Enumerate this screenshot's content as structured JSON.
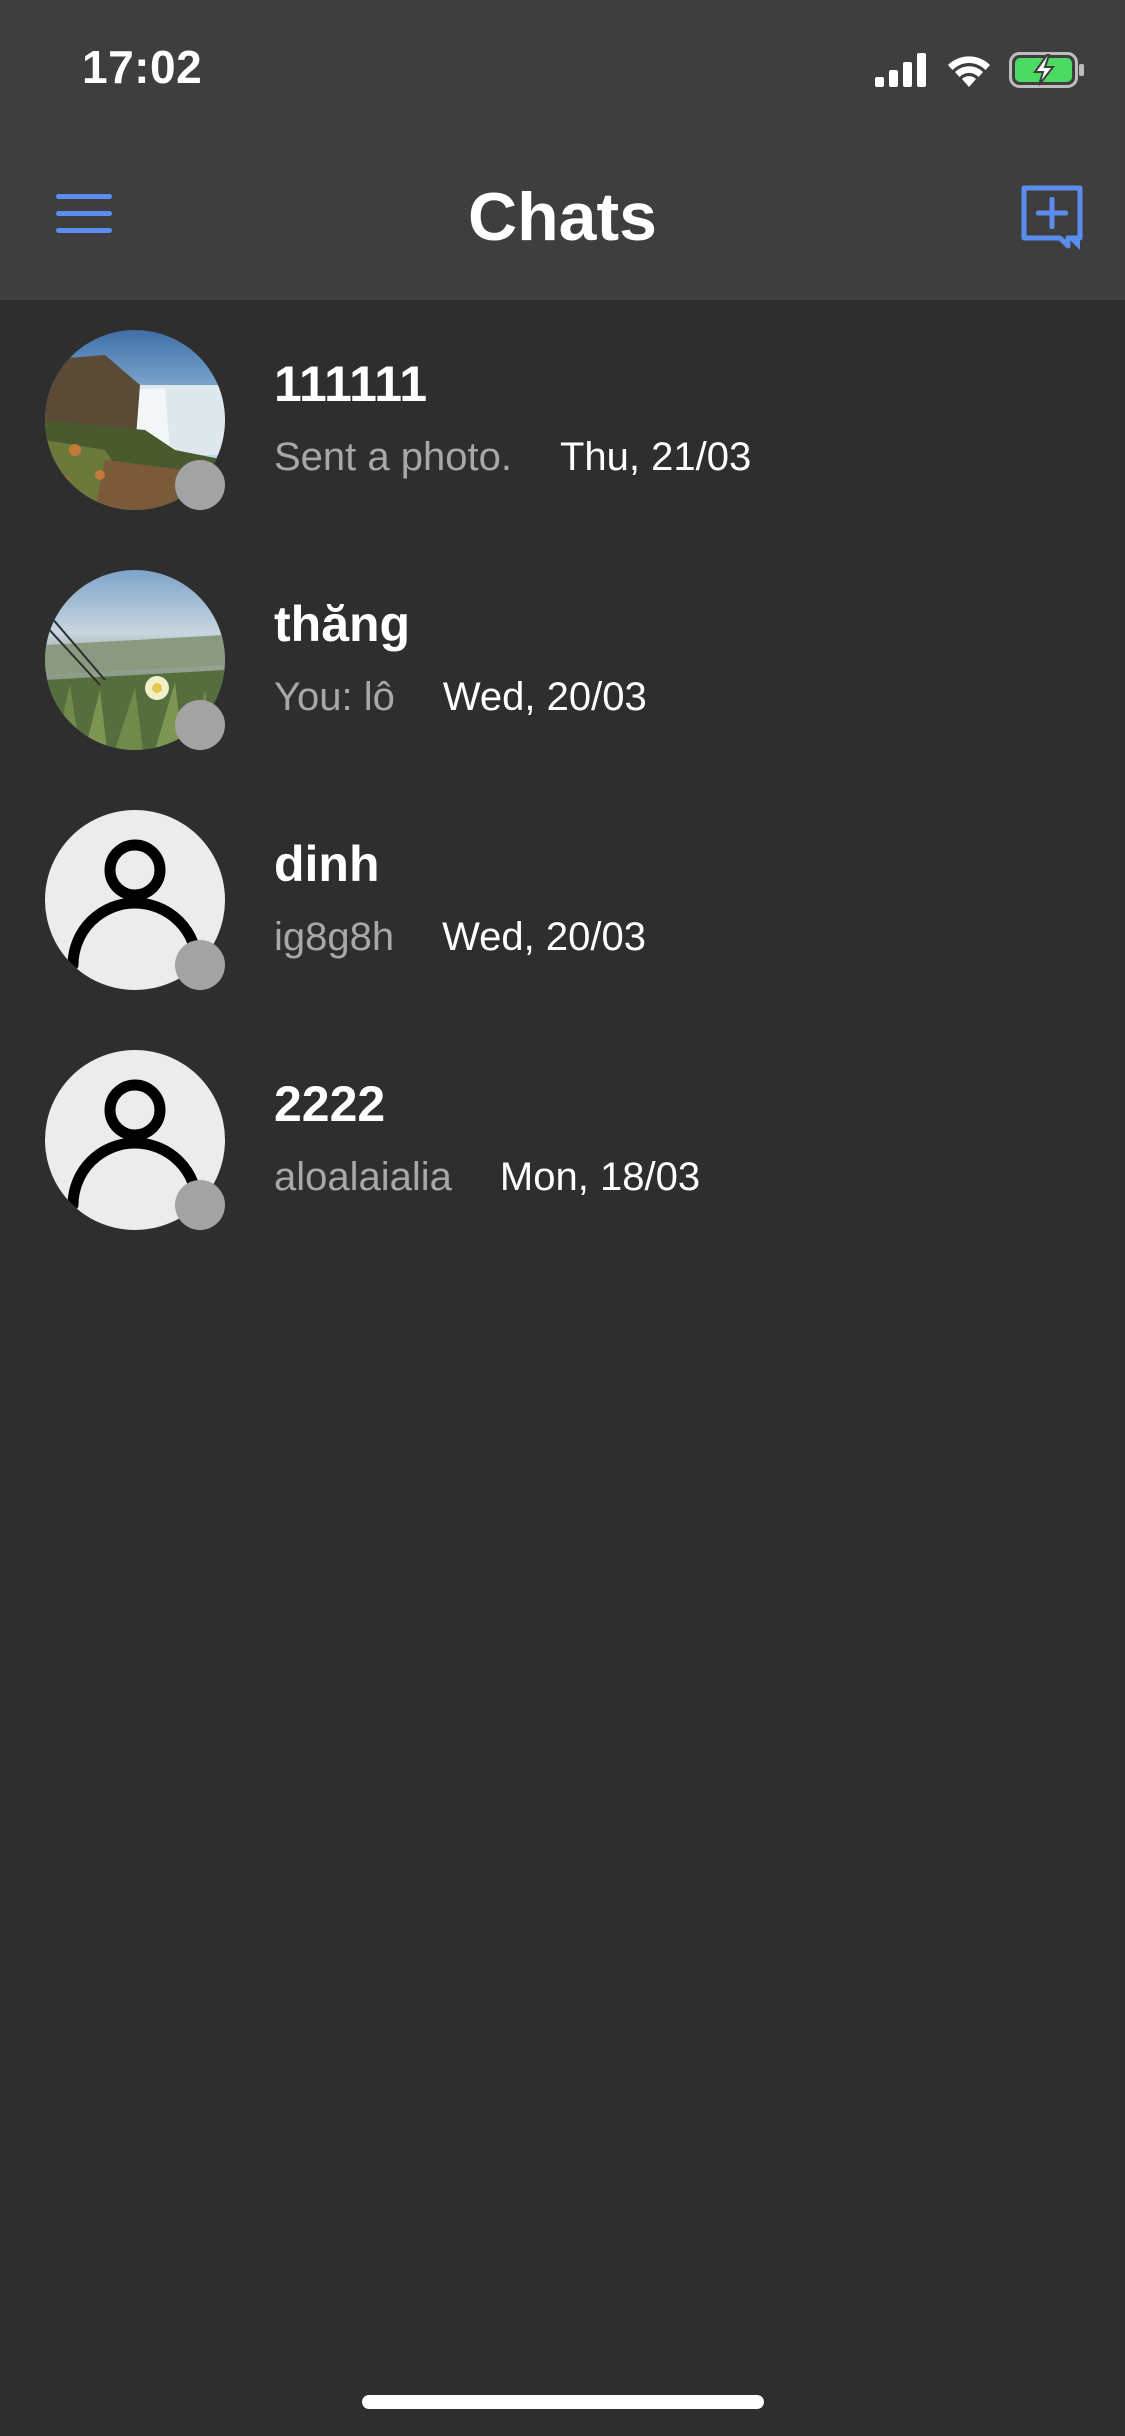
{
  "status_bar": {
    "time": "17:02",
    "icons": [
      "cellular-signal-icon",
      "wifi-icon",
      "battery-charging-icon"
    ],
    "battery_color": "#4cd964"
  },
  "nav": {
    "title": "Chats",
    "left_icon": "menu-icon",
    "right_icon": "new-chat-icon",
    "accent_color": "#5a8dee"
  },
  "chats": [
    {
      "name": "111111",
      "preview": "Sent a photo.",
      "date": "Thu, 21/03",
      "avatar": "waterfall-photo"
    },
    {
      "name": "thăng",
      "preview": "You: lô",
      "date": "Wed, 20/03",
      "avatar": "flower-photo"
    },
    {
      "name": "dinh",
      "preview": "ig8g8h",
      "date": "Wed, 20/03",
      "avatar": "default-user-icon"
    },
    {
      "name": "2222",
      "preview": "aloalaialia",
      "date": "Mon, 18/03",
      "avatar": "default-user-icon"
    }
  ]
}
